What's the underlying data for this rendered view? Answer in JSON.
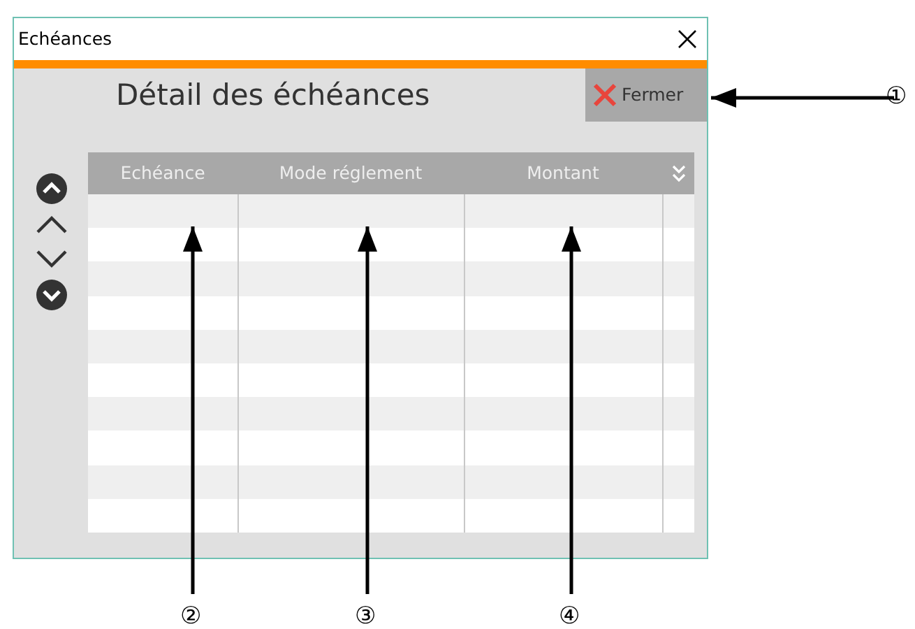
{
  "window": {
    "title": "Echéances"
  },
  "heading": "Détail des échéances",
  "close_button": {
    "label": "Fermer"
  },
  "table": {
    "columns": [
      "Echéance",
      "Mode réglement",
      "Montant"
    ]
  },
  "callouts": [
    {
      "label": "①"
    },
    {
      "label": "②"
    },
    {
      "label": "③"
    },
    {
      "label": "④"
    }
  ]
}
